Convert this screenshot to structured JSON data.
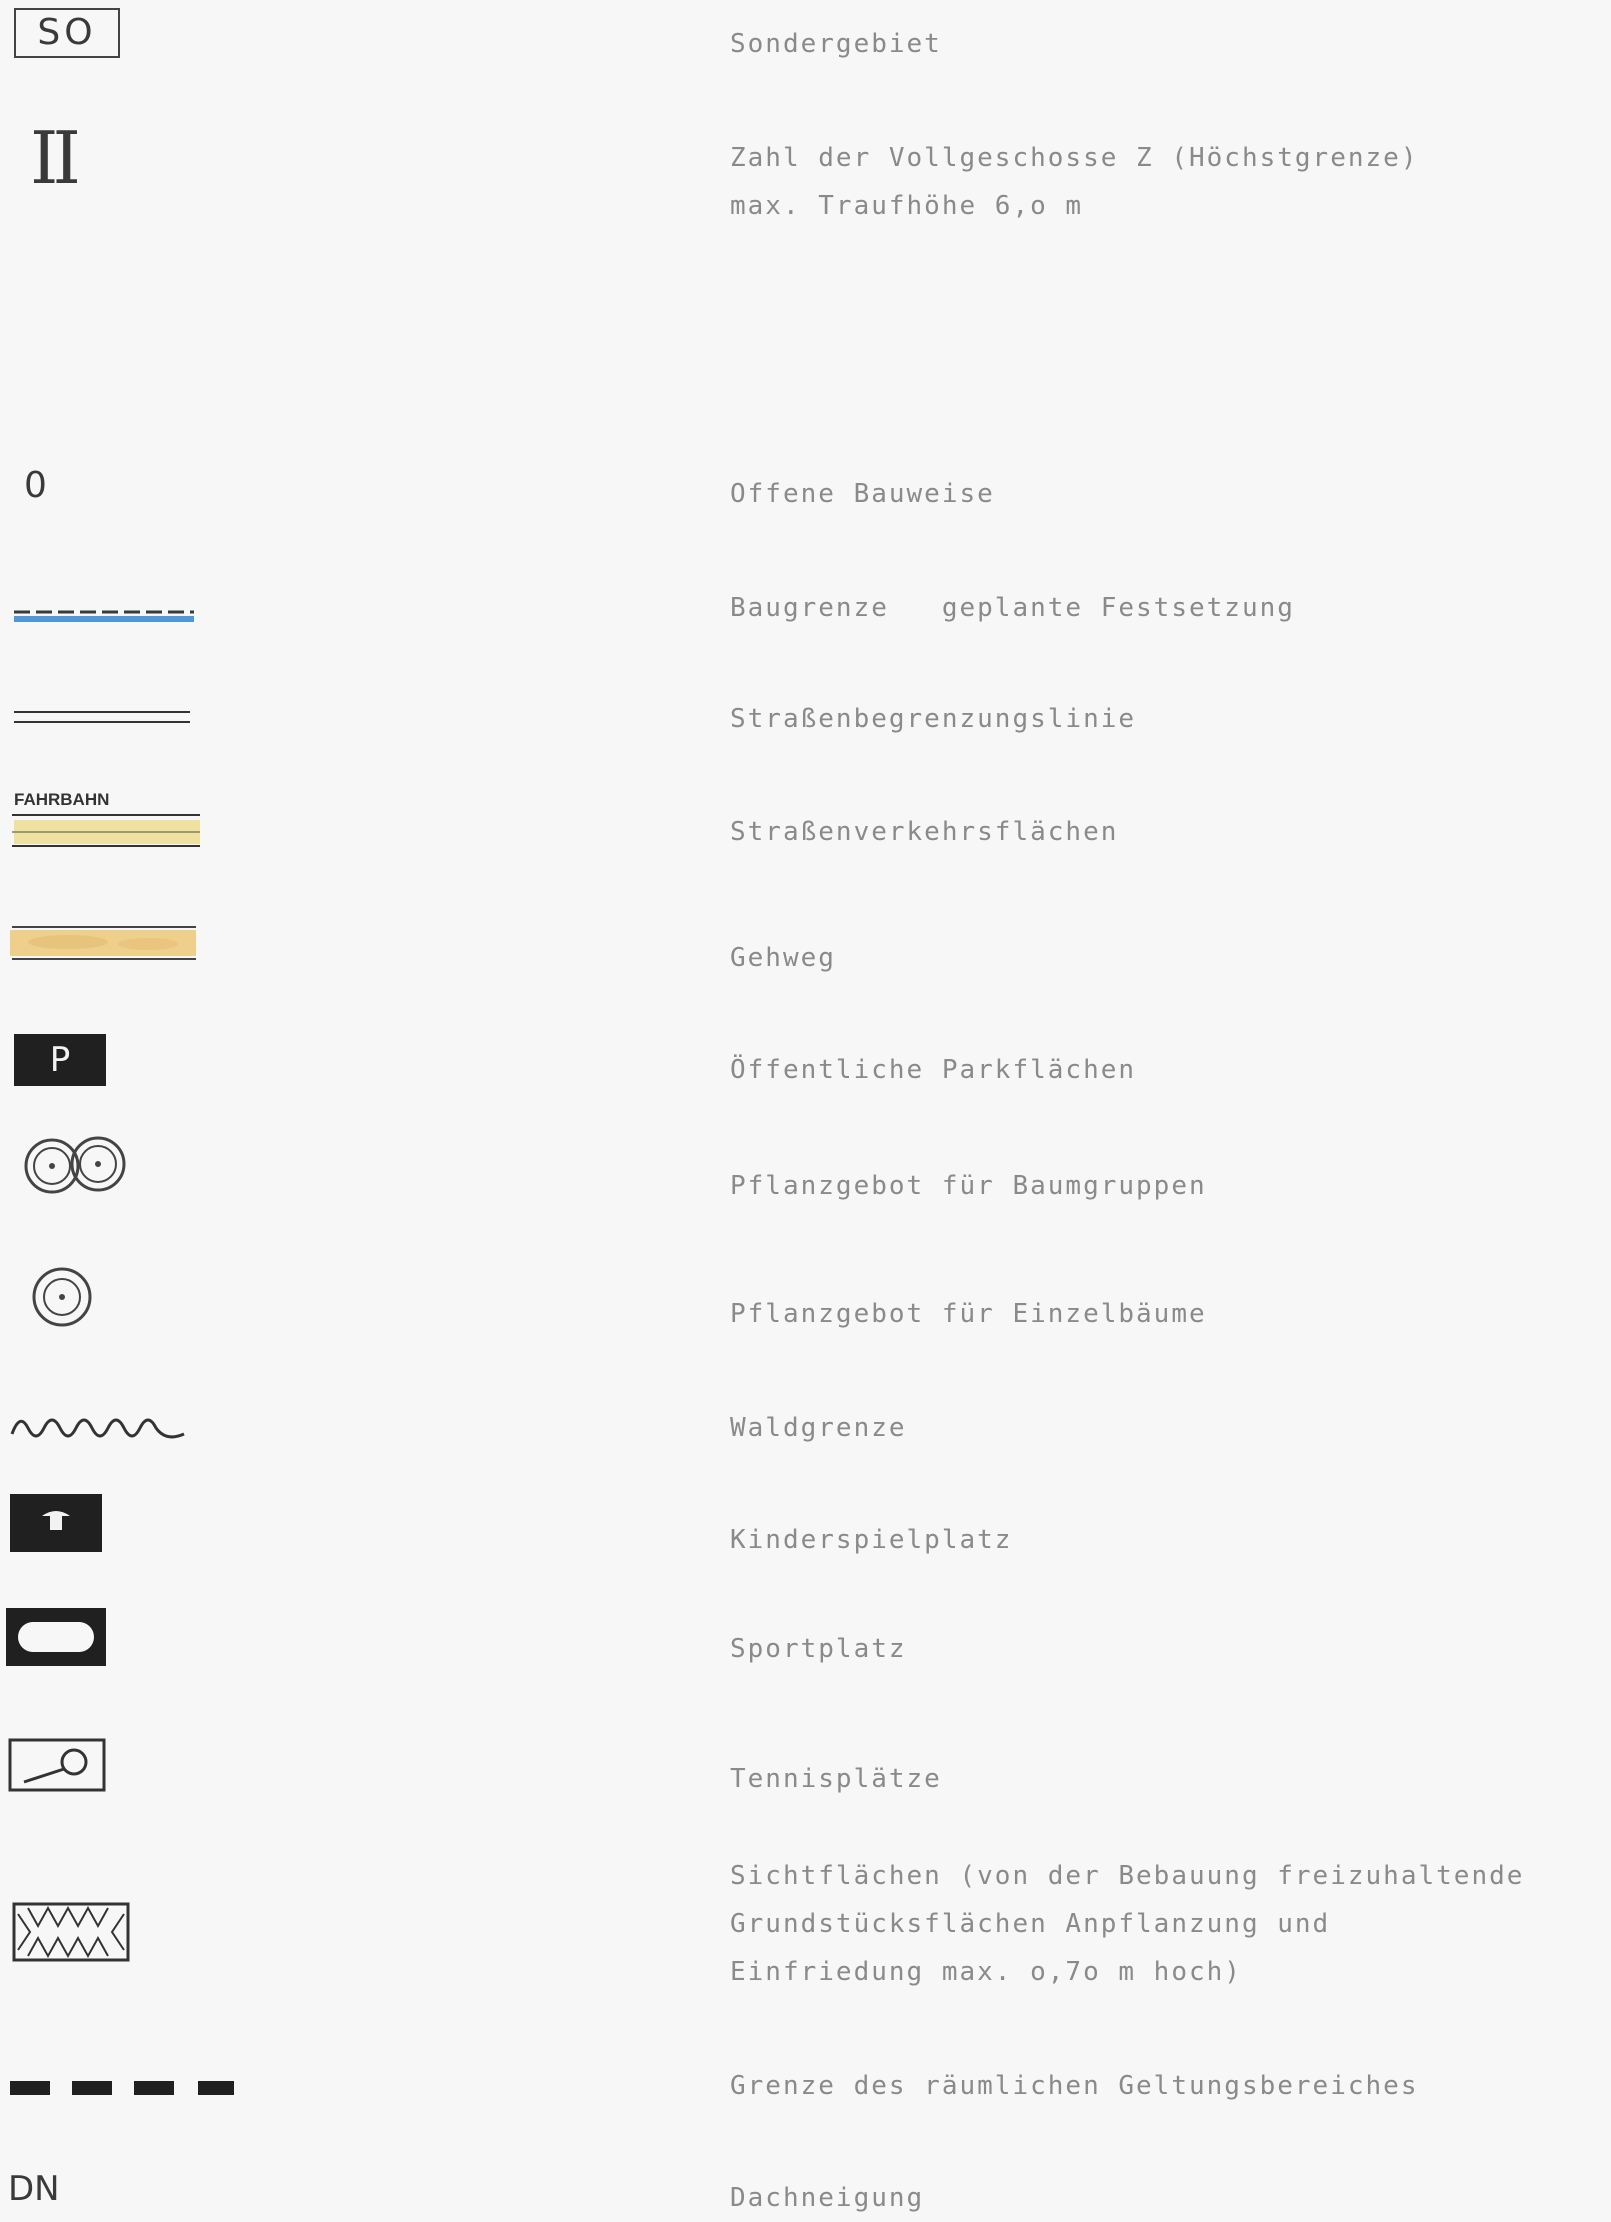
{
  "legend": [
    {
      "symbol": "SO",
      "lines": [
        "Sondergebiet"
      ]
    },
    {
      "symbol": "II",
      "lines": [
        "Zahl der Vollgeschosse Z (Höchstgrenze)",
        "max. Traufhöhe 6,o m"
      ]
    },
    {
      "symbol": "0",
      "lines": [
        "Offene Bauweise"
      ]
    },
    {
      "symbol": "blue-dashed-line-icon",
      "lines": [
        "Baugrenze   geplante Festsetzung"
      ]
    },
    {
      "symbol": "double-line-icon",
      "lines": [
        "Straßenbegrenzungslinie"
      ]
    },
    {
      "symbol": "FAHRBAHN",
      "lines": [
        "Straßenverkehrsflächen"
      ]
    },
    {
      "symbol": "sidewalk-strip-icon",
      "lines": [
        "Gehweg"
      ]
    },
    {
      "symbol": "P",
      "lines": [
        "Öffentliche Parkflächen"
      ]
    },
    {
      "symbol": "tree-group-icon",
      "lines": [
        "Pflanzgebot für Baumgruppen"
      ]
    },
    {
      "symbol": "single-tree-icon",
      "lines": [
        "Pflanzgebot für Einzelbäume"
      ]
    },
    {
      "symbol": "wavy-line-icon",
      "lines": [
        "Waldgrenze"
      ]
    },
    {
      "symbol": "playground-icon",
      "lines": [
        "Kinderspielplatz"
      ]
    },
    {
      "symbol": "sports-field-icon",
      "lines": [
        "Sportplatz"
      ]
    },
    {
      "symbol": "tennis-icon",
      "lines": [
        "Tennisplätze"
      ]
    },
    {
      "symbol": "zigzag-box-icon",
      "lines": [
        "Sichtflächen (von der Bebauung freizuhaltende",
        "Grundstücksflächen Anpflanzung und",
        "Einfriedung max. o,7o m hoch)"
      ]
    },
    {
      "symbol": "thick-dashed-line-icon",
      "lines": [
        "Grenze des räumlichen Geltungsbereiches"
      ]
    },
    {
      "symbol": "DN",
      "lines": [
        "Dachneigung"
      ]
    }
  ],
  "colors": {
    "blue_line": "#4f97d6",
    "yellow_fill": "#efe2a0",
    "sidewalk_fill": "#eecf8c",
    "symbol_dark": "#202020"
  }
}
